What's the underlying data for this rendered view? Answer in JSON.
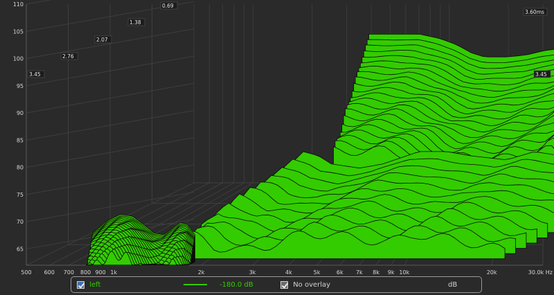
{
  "chart_data": {
    "type": "waterfall",
    "ylabel": "dB",
    "xunit": "Hz",
    "ylim": [
      62,
      110
    ],
    "xlim": [
      500,
      30000
    ],
    "x_scale": "log",
    "y_ticks": [
      110,
      105,
      100,
      95,
      90,
      85,
      80,
      75,
      70,
      65
    ],
    "x_ticks": [
      "500",
      "600",
      "700",
      "800",
      "900",
      "1k",
      "2k",
      "3k",
      "4k",
      "5k",
      "6k",
      "7k",
      "8k",
      "9k",
      "10k",
      "20k",
      "30.0k Hz"
    ],
    "x_tick_values": [
      500,
      600,
      700,
      800,
      900,
      1000,
      2000,
      3000,
      4000,
      5000,
      6000,
      7000,
      8000,
      9000,
      10000,
      20000,
      30000
    ],
    "time_axis_ms": [
      "3.45",
      "2.76",
      "2.07",
      "1.38",
      "0.69",
      "3.60ms",
      "3.45"
    ],
    "time_range_ms": [
      0,
      3.6
    ],
    "fill_color": "#33cc00",
    "outline_color": "#0a0a0a",
    "grid": true,
    "series": [
      {
        "time_ms": 0.0,
        "points": [
          [
            2000,
            98
          ],
          [
            2500,
            98
          ],
          [
            3000,
            98
          ],
          [
            3500,
            97
          ],
          [
            4000,
            95.5
          ],
          [
            4500,
            93.5
          ],
          [
            5000,
            92.5
          ],
          [
            6000,
            92.5
          ],
          [
            7000,
            93
          ],
          [
            8000,
            94
          ],
          [
            9000,
            94.5
          ],
          [
            10000,
            95.5
          ],
          [
            11000,
            97.5
          ],
          [
            12000,
            96
          ],
          [
            14000,
            97
          ],
          [
            16000,
            96.5
          ],
          [
            18000,
            99
          ],
          [
            20000,
            98.5
          ],
          [
            23000,
            96
          ],
          [
            26000,
            94.5
          ],
          [
            30000,
            94
          ]
        ]
      },
      {
        "time_ms": 0.8,
        "points": [
          [
            1400,
            70
          ],
          [
            1600,
            74
          ],
          [
            1800,
            73
          ],
          [
            2000,
            71
          ],
          [
            2500,
            70
          ],
          [
            3000,
            71
          ],
          [
            4000,
            74
          ],
          [
            5000,
            74
          ],
          [
            6000,
            73
          ],
          [
            8000,
            72
          ],
          [
            10000,
            74
          ],
          [
            15000,
            72
          ],
          [
            20000,
            70
          ]
        ]
      },
      {
        "time_ms": 3.45,
        "points": [
          [
            800,
            69
          ],
          [
            900,
            72
          ],
          [
            1000,
            73.5
          ],
          [
            1100,
            73
          ],
          [
            1200,
            71
          ],
          [
            1300,
            69
          ],
          [
            1400,
            68.5
          ],
          [
            1500,
            70
          ],
          [
            1600,
            71.5
          ],
          [
            1700,
            71
          ],
          [
            1800,
            68.5
          ]
        ]
      }
    ]
  },
  "legend": {
    "left_label": "left",
    "level_label": "-180.0 dB",
    "overlay_label": "No overlay",
    "unit_label": "dB",
    "line_color": "#33cc00"
  }
}
